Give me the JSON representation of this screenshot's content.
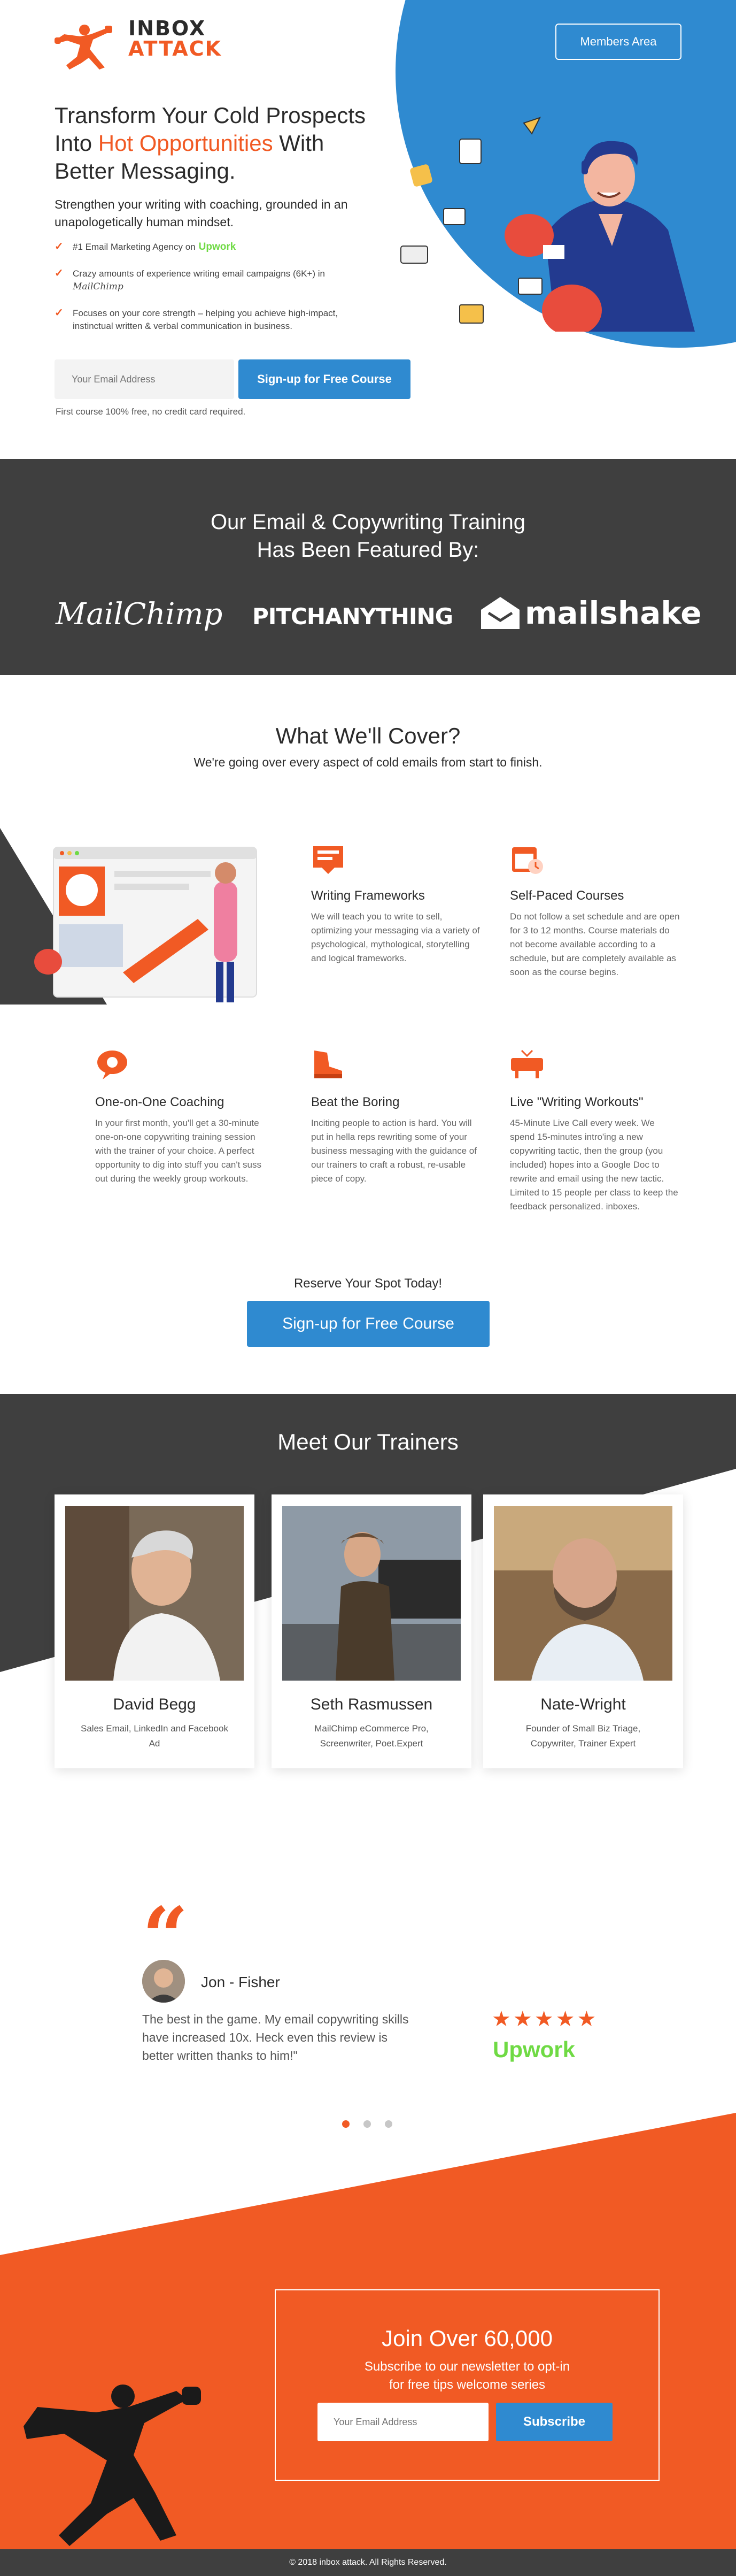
{
  "brand": {
    "line1": "INBOX",
    "line2": "ATTACK"
  },
  "nav": {
    "members_label": "Members Area"
  },
  "hero": {
    "title_a": "Transform Your Cold Prospects",
    "title_b": "Into ",
    "title_highlight": "Hot Opportunities",
    "title_c": " With",
    "title_d": "Better Messaging.",
    "subtitle": "Strengthen your writing with coaching, grounded in an unapologetically human mindset.",
    "bullets": [
      "#1 Email Marketing Agency on",
      "Crazy amounts of experience writing email campaigns (6K+) in",
      "Focuses on your core strength – helping you achieve high-impact, instinctual written & verbal communication in business."
    ],
    "bullet_badges": {
      "upwork": "Upwork",
      "mailchimp": "MailChimp"
    },
    "email_placeholder": "Your Email Address",
    "cta_label": "Sign-up for Free Course",
    "note": "First course 100% free, no credit card required."
  },
  "featured": {
    "title_line1": "Our Email & Copywriting Training",
    "title_line2": "Has Been Featured By:",
    "logos": [
      "MailChimp",
      "PITCHANYTHING",
      "mailshake"
    ]
  },
  "cover": {
    "title": "What We'll Cover?",
    "subtitle": "We're going over every aspect of cold emails from start to finish.",
    "features": [
      {
        "icon": "frameworks-icon",
        "title": "Writing Frameworks",
        "text": "We will teach you to write to sell, optimizing your messaging via a variety of psychological, mythological, storytelling and logical frameworks."
      },
      {
        "icon": "calendar-icon",
        "title": "Self-Paced Courses",
        "text": "Do not follow a set schedule and are open for 3 to 12 months. Course materials do not become available according to a schedule, but are completely available as soon as the course begins."
      },
      {
        "icon": "chat-bubble-icon",
        "title": "One-on-One Coaching",
        "text": "In your first month, you'll get a 30-minute one-on-one copywriting training session with the trainer of your choice. A perfect opportunity to dig into stuff you can't suss out during the weekly group workouts."
      },
      {
        "icon": "boot-icon",
        "title": "Beat the Boring",
        "text": "Inciting people to action is hard. You will put in hella reps rewriting some of your business messaging with the guidance of our trainers to craft a robust, re-usable piece of copy."
      },
      {
        "icon": "live-broadcast-icon",
        "title": "Live \"Writing Workouts\"",
        "text": "45-Minute Live Call every week. We spend 15-minutes intro'ing a new copywriting tactic, then the group (you included) hopes into a Google Doc to rewrite and email using the new tactic. Limited to 15 people per class to keep the feedback personalized. inboxes."
      }
    ],
    "reserve": "Reserve Your Spot Today!",
    "cta_label": "Sign-up for Free Course"
  },
  "trainers": {
    "title": "Meet Our Trainers",
    "people": [
      {
        "name": "David Begg",
        "role": "Sales Email, LinkedIn and Facebook Ad"
      },
      {
        "name": "Seth Rasmussen",
        "role": "MailChimp eCommerce Pro, Screenwriter, Poet.Expert"
      },
      {
        "name": "Nate-Wright",
        "role": "Founder of Small Biz Triage, Copywriter, Trainer Expert"
      }
    ]
  },
  "testimonial": {
    "name": "Jon - Fisher",
    "quote": "The best in the game. My email copywriting skills have increased 10x. Heck even this review is better written thanks to him!\"",
    "stars": "★★★★★",
    "source": "Upwork"
  },
  "newsletter": {
    "title": "Join Over 60,000",
    "subtitle_line1": "Subscribe to our newsletter to opt-in",
    "subtitle_line2": "for free tips welcome series",
    "email_placeholder": "Your Email Address",
    "button_label": "Subscribe"
  },
  "footer": {
    "text": "© 2018 inbox attack. All Rights Reserved."
  },
  "colors": {
    "accent": "#f15a24",
    "blue": "#2f8ad0",
    "dark": "#3f3f3f",
    "upwork": "#6fda44"
  }
}
